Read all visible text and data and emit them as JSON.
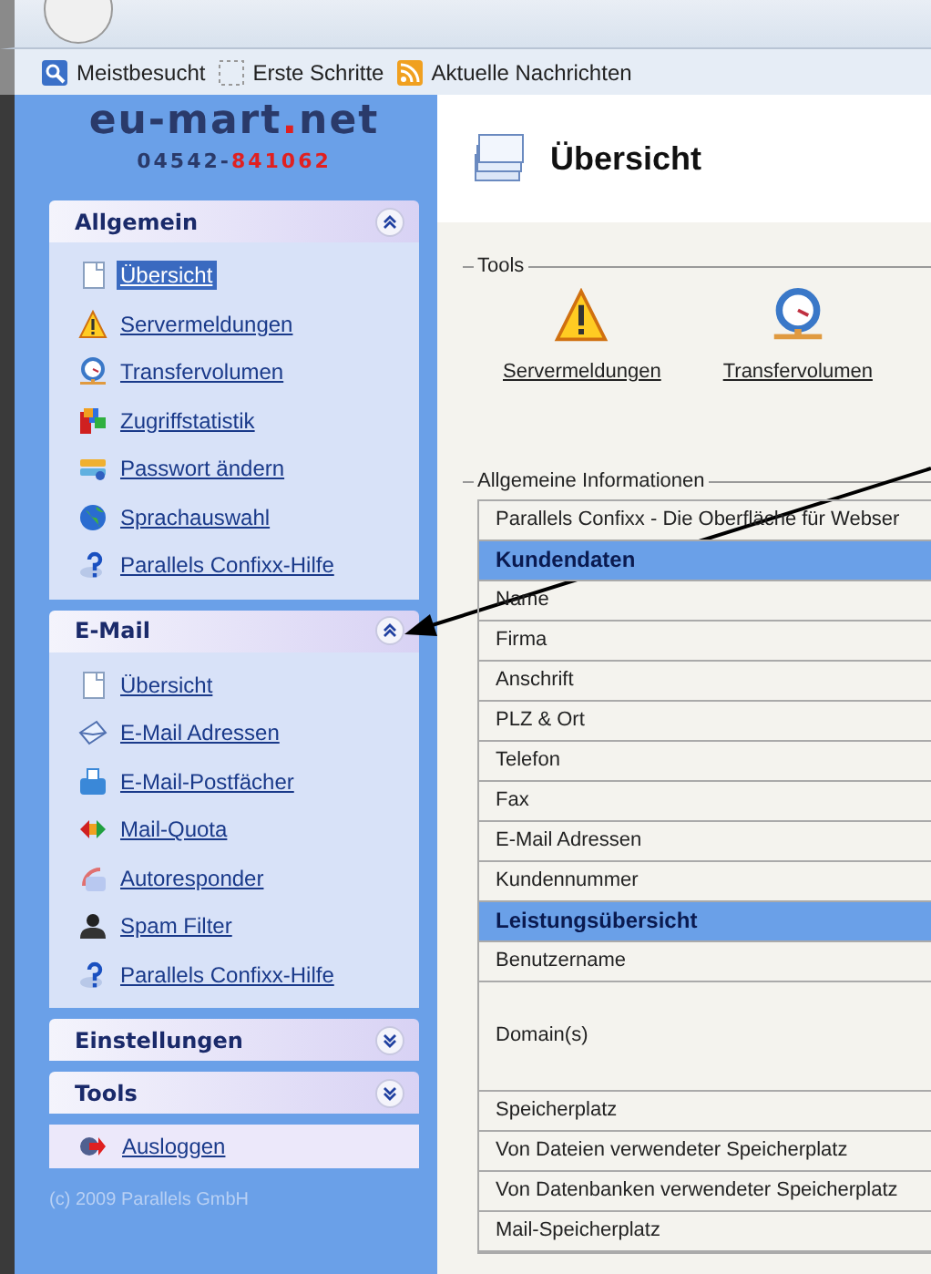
{
  "bookmarks": [
    {
      "label": "Meistbesucht"
    },
    {
      "label": "Erste Schritte"
    },
    {
      "label": "Aktuelle Nachrichten"
    }
  ],
  "logo": {
    "name": "eu-mart",
    "dot": ".",
    "tld": "net",
    "phone_prefix": "04542-",
    "phone_number": "841062"
  },
  "sections": [
    {
      "title": "Allgemein",
      "expanded": true,
      "items": [
        {
          "label": "Übersicht",
          "selected": true
        },
        {
          "label": "Servermeldungen",
          "selected": false
        },
        {
          "label": "Transfervolumen",
          "selected": false
        },
        {
          "label": "Zugriffstatistik",
          "selected": false
        },
        {
          "label": "Passwort ändern",
          "selected": false
        },
        {
          "label": "Sprachauswahl",
          "selected": false
        },
        {
          "label": "Parallels Confixx-Hilfe",
          "selected": false
        }
      ]
    },
    {
      "title": "E-Mail",
      "expanded": true,
      "items": [
        {
          "label": "Übersicht",
          "selected": false
        },
        {
          "label": "E-Mail Adressen",
          "selected": false
        },
        {
          "label": "E-Mail-Postfächer",
          "selected": false
        },
        {
          "label": "Mail-Quota",
          "selected": false
        },
        {
          "label": "Autoresponder",
          "selected": false
        },
        {
          "label": "Spam Filter",
          "selected": false
        },
        {
          "label": "Parallels Confixx-Hilfe",
          "selected": false
        }
      ]
    },
    {
      "title": "Einstellungen",
      "expanded": false
    },
    {
      "title": "Tools",
      "expanded": false
    }
  ],
  "logout": {
    "label": "Ausloggen"
  },
  "footer": "(c) 2009 Parallels GmbH",
  "page_title": "Übersicht",
  "tools": {
    "legend": "Tools",
    "items": [
      {
        "label": "Servermeldungen"
      },
      {
        "label": "Transfervolumen"
      }
    ]
  },
  "info": {
    "legend": "Allgemeine Informationen",
    "rows": [
      {
        "kind": "row",
        "label": "Parallels Confixx - Die Oberfläche für Webser"
      },
      {
        "kind": "header",
        "label": "Kundendaten"
      },
      {
        "kind": "row",
        "label": "Name"
      },
      {
        "kind": "row",
        "label": "Firma"
      },
      {
        "kind": "row",
        "label": "Anschrift"
      },
      {
        "kind": "row",
        "label": "PLZ & Ort"
      },
      {
        "kind": "row",
        "label": "Telefon"
      },
      {
        "kind": "row",
        "label": "Fax"
      },
      {
        "kind": "row",
        "label": "E-Mail Adressen"
      },
      {
        "kind": "row",
        "label": "Kundennummer"
      },
      {
        "kind": "header",
        "label": "Leistungsübersicht"
      },
      {
        "kind": "row",
        "label": "Benutzername"
      },
      {
        "kind": "tall",
        "label": "Domain(s)"
      },
      {
        "kind": "row",
        "label": "Speicherplatz"
      },
      {
        "kind": "row",
        "label": "Von Dateien verwendeter Speicherplatz"
      },
      {
        "kind": "row",
        "label": "Von Datenbanken verwendeter Speicherplatz"
      },
      {
        "kind": "row",
        "label": "Mail-Speicherplatz"
      }
    ]
  }
}
